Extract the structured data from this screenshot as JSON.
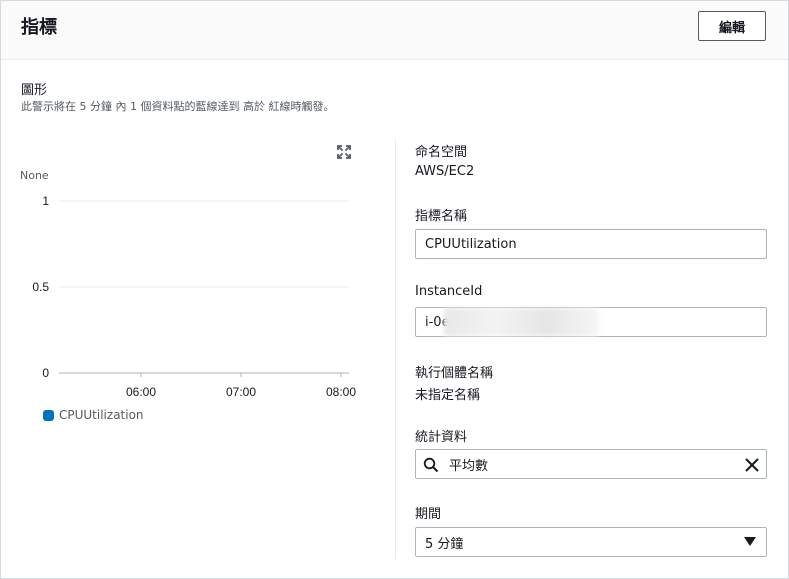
{
  "header": {
    "title": "指標",
    "edit_label": "編輯"
  },
  "graph": {
    "title": "圖形",
    "description": "此警示將在 5 分鐘 內 1 個資料點的藍線達到 高於 紅線時觸發。"
  },
  "chart_data": {
    "type": "line",
    "ylabel": "None",
    "y_ticks": [
      "1",
      "0.5",
      "0"
    ],
    "ylim": [
      0,
      1
    ],
    "x_ticks": [
      "06:00",
      "07:00",
      "08:00"
    ],
    "grid": true,
    "series": [
      {
        "name": "CPUUtilization",
        "values": []
      }
    ],
    "legend_position": "bottom-left",
    "series_color": "#0073bb"
  },
  "details": {
    "namespace_label": "命名空間",
    "namespace_value": "AWS/EC2",
    "metric_name_label": "指標名稱",
    "metric_name_value": "CPUUtilization",
    "instance_id_label": "InstanceId",
    "instance_id_value": "i-0e0",
    "instance_name_label": "執行個體名稱",
    "instance_name_value": "未指定名稱",
    "statistic_label": "統計資料",
    "statistic_value": "平均數",
    "period_label": "期間",
    "period_value": "5 分鐘"
  },
  "icons": {
    "expand": "expand-icon",
    "search": "search-icon",
    "clear": "close-icon",
    "dropdown": "caret-down-icon"
  }
}
